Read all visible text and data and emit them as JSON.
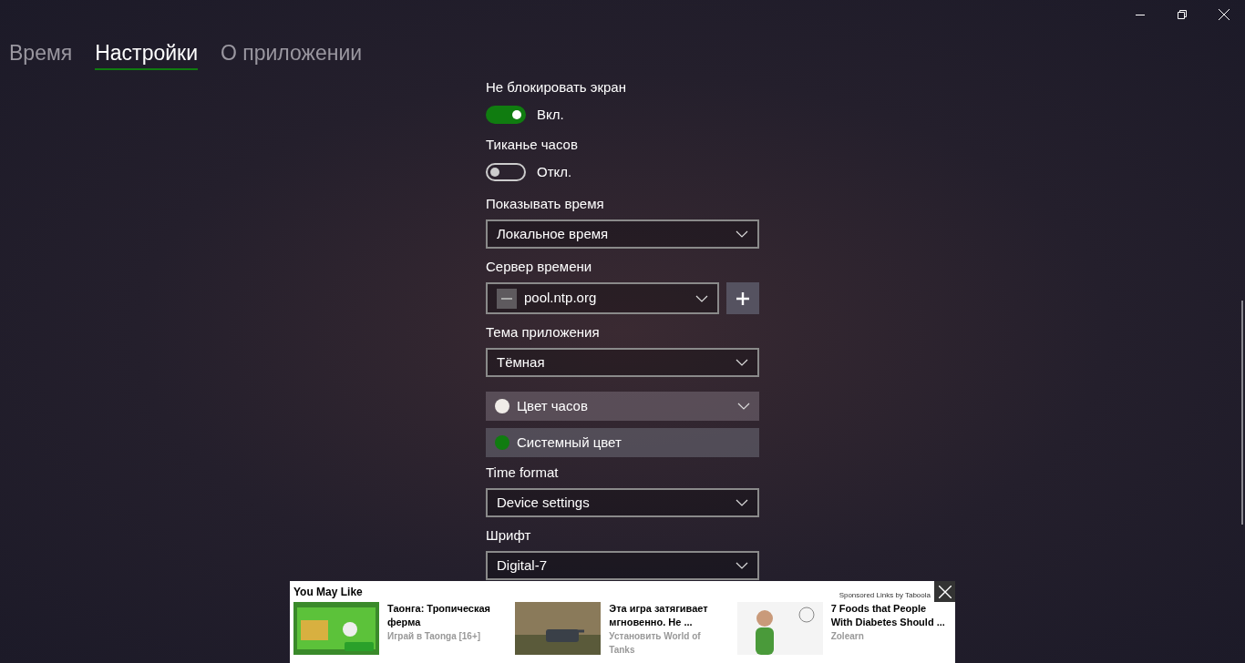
{
  "tabs": [
    {
      "label": "Время",
      "selected": false
    },
    {
      "label": "Настройки",
      "selected": true
    },
    {
      "label": "О приложении",
      "selected": false
    }
  ],
  "settings": [
    {
      "kind": "toggle",
      "label": "Не блокировать экран",
      "on": true,
      "state_text": "Вкл."
    },
    {
      "kind": "toggle",
      "label": "Тиканье часов",
      "on": false,
      "state_text": "Откл."
    },
    {
      "kind": "dropdown",
      "label": "Показывать время",
      "value": "Локальное время"
    },
    {
      "kind": "server",
      "label": "Сервер времени",
      "value": "pool.ntp.org"
    },
    {
      "kind": "dropdown",
      "label": "Тема приложения",
      "value": "Тёмная"
    },
    {
      "kind": "color_picker",
      "value": "Цвет часов",
      "color": "#f0ece8"
    },
    {
      "kind": "color_option",
      "value": "Системный цвет",
      "color": "#107c10"
    },
    {
      "kind": "dropdown",
      "label": "Time format",
      "value": "Device settings"
    },
    {
      "kind": "dropdown",
      "label": "Шрифт",
      "value": "Digital-7"
    }
  ],
  "ad": {
    "title": "You May Like",
    "sponsor": "Sponsored Links by Taboola",
    "items": [
      {
        "title": "Таонга: Тропическая ферма",
        "source": "Играй в Taonga [16+]"
      },
      {
        "title": "Эта игра затягивает мгновенно. Не ...",
        "source": "Установить World of Tanks"
      },
      {
        "title": "7 Foods that People With Diabetes Should ...",
        "source": "Zolearn"
      }
    ]
  }
}
